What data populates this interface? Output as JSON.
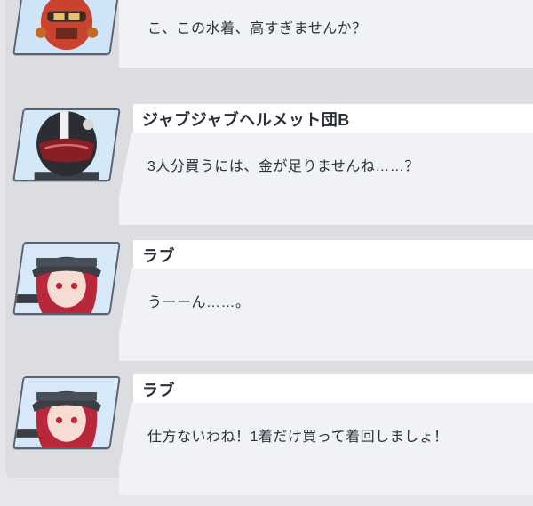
{
  "dialogue": [
    {
      "speaker": "",
      "text": "こ、この水着、高すぎませんか？"
    },
    {
      "speaker": "ジャブジャブヘルメット団B",
      "text": "3人分買うには、金が足りませんね……？"
    },
    {
      "speaker": "ラブ",
      "text": "うーーん……。"
    },
    {
      "speaker": "ラブ",
      "text": "仕方ないわね！1着だけ買って着回しましょ！"
    }
  ]
}
